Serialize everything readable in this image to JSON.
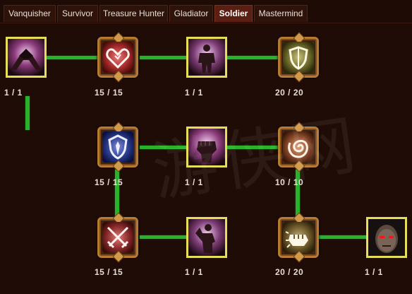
{
  "tabs": [
    {
      "label": "Vanquisher"
    },
    {
      "label": "Survivor"
    },
    {
      "label": "Treasure Hunter"
    },
    {
      "label": "Gladiator"
    },
    {
      "label": "Soldier",
      "active": true
    },
    {
      "label": "Mastermind"
    }
  ],
  "skills": [
    {
      "icon": "handshake-icon",
      "rank": "1 / 1"
    },
    {
      "icon": "heart-icon",
      "rank": "15 / 15"
    },
    {
      "icon": "muscle-figure-icon",
      "rank": "1 / 1"
    },
    {
      "icon": "shield-icon",
      "rank": "20 / 20"
    },
    {
      "icon": "blade-shield-icon",
      "rank": "15 / 15"
    },
    {
      "icon": "fist-icon",
      "rank": "1 / 1"
    },
    {
      "icon": "swirl-icon",
      "rank": "10 / 10"
    },
    {
      "icon": "crossed-swords-icon",
      "rank": "15 / 15"
    },
    {
      "icon": "flexing-figure-icon",
      "rank": "1 / 1"
    },
    {
      "icon": "punch-icon",
      "rank": "20 / 20"
    },
    {
      "icon": "red-eyed-face-icon",
      "rank": "1 / 1"
    }
  ],
  "watermark": "游侠网",
  "colors": {
    "connector": "#29b22a",
    "square_border": "#e6de58",
    "ornate_frame": "#b77a33",
    "active_tab": "#5a1f12",
    "background": "#200c07"
  }
}
